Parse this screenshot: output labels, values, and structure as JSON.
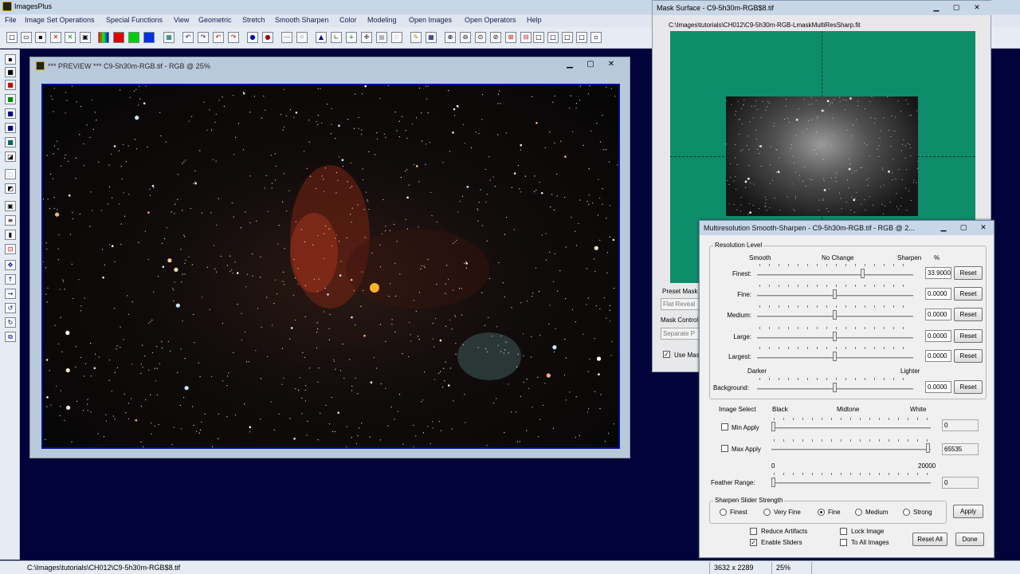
{
  "app": {
    "title": "ImagesPlus"
  },
  "menu": [
    "File",
    "Image Set Operations",
    "Special Functions",
    "View",
    "Geometric",
    "Stretch",
    "Smooth Sharpen",
    "Color",
    "Modeling",
    "Open Images",
    "Open Operators",
    "Help"
  ],
  "preview": {
    "title": "*** PREVIEW *** C9-5h30m-RGB.tif - RGB @ 25%",
    "min": "▁",
    "max": "▢",
    "close": "✕"
  },
  "mask": {
    "title": "Mask Surface - C9-5h30m-RGB$8.tif",
    "path": "C:\\Images\\tutorials\\CH012\\C9-5h30m-RGB-LmaskMultiResSharp.fit",
    "preset_label": "Preset Mask",
    "preset_value": "Flat Reveal",
    "control_label": "Mask Control",
    "control_value": "Separate P",
    "use_mask": "Use Mas"
  },
  "mr": {
    "title": "Multiresolution Smooth-Sharpen - C9-5h30m-RGB.tif - RGB @ 2...",
    "res_group": "Resolution Level",
    "h_smooth": "Smooth",
    "h_nochange": "No Change",
    "h_sharpen": "Sharpen",
    "h_pct": "%",
    "rows": [
      {
        "label": "Finest:",
        "value": "33.9000",
        "pos": 0.68
      },
      {
        "label": "Fine:",
        "value": "0.0000",
        "pos": 0.5
      },
      {
        "label": "Medium:",
        "value": "0.0000",
        "pos": 0.5
      },
      {
        "label": "Large:",
        "value": "0.0000",
        "pos": 0.5
      },
      {
        "label": "Largest:",
        "value": "0.0000",
        "pos": 0.5
      }
    ],
    "darker": "Darker",
    "lighter": "Lighter",
    "bg": {
      "label": "Background:",
      "value": "0.0000",
      "pos": 0.5
    },
    "reset": "Reset",
    "img_select": "Image Select",
    "black": "Black",
    "midtone": "Midtone",
    "white": "White",
    "min_apply": "Min Apply",
    "min_val": "0",
    "max_apply": "Max Apply",
    "max_val": "65535",
    "range_min": "0",
    "range_max": "20000",
    "feather": "Feather Range:",
    "feather_val": "0",
    "strength_group": "Sharpen Slider Strength",
    "radios": [
      {
        "label": "Finest",
        "on": false
      },
      {
        "label": "Very Fine",
        "on": false
      },
      {
        "label": "Fine",
        "on": true
      },
      {
        "label": "Medium",
        "on": false
      },
      {
        "label": "Strong",
        "on": false
      }
    ],
    "apply": "Apply",
    "reduce": "Reduce Artifacts",
    "enable": "Enable Sliders",
    "lock": "Lock Image",
    "toall": "To All Images",
    "reset_all": "Reset All",
    "done": "Done"
  },
  "status": {
    "path": "C:\\Images\\tutorials\\CH012\\C9-5h30m-RGB$8.tif",
    "dims": "3632 x 2289",
    "zoom": "25%"
  }
}
